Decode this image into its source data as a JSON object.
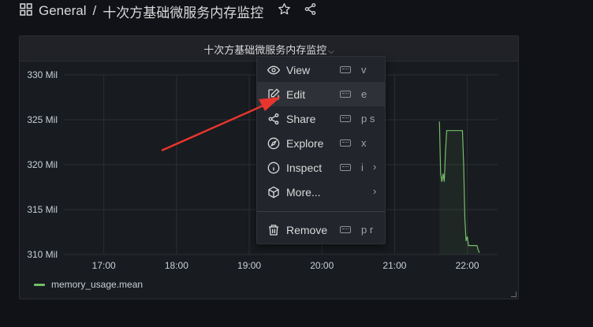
{
  "header": {
    "folder": "General",
    "separator": "/",
    "dashboard": "十次方基础微服务内存监控"
  },
  "panel": {
    "title": "十次方基础微服务内存监控",
    "legend": "memory_usage.mean"
  },
  "menu": {
    "items": [
      {
        "label": "View",
        "shortcut": "v",
        "icon": "eye-icon"
      },
      {
        "label": "Edit",
        "shortcut": "e",
        "icon": "edit-icon"
      },
      {
        "label": "Share",
        "shortcut": "p s",
        "icon": "share-icon"
      },
      {
        "label": "Explore",
        "shortcut": "x",
        "icon": "compass-icon"
      },
      {
        "label": "Inspect",
        "shortcut": "i",
        "icon": "info-icon"
      },
      {
        "label": "More...",
        "shortcut": "",
        "icon": "cube-icon"
      },
      {
        "label": "Remove",
        "shortcut": "p r",
        "icon": "trash-icon"
      }
    ]
  },
  "chart_data": {
    "type": "line",
    "ylabel": "",
    "xlabel": "",
    "ylim": [
      310,
      330
    ],
    "yticks": [
      "330 Mil",
      "325 Mil",
      "320 Mil",
      "315 Mil",
      "310 Mil"
    ],
    "xticks": [
      "17:00",
      "18:00",
      "19:00",
      "20:00",
      "21:00",
      "22:00"
    ],
    "grid": true,
    "legend_position": "bottom-left",
    "series": [
      {
        "name": "memory_usage.mean",
        "color": "#73bf69",
        "x": [
          "21:37",
          "21:38",
          "21:39",
          "21:40",
          "21:41",
          "21:42",
          "21:43",
          "21:44",
          "21:45",
          "21:46",
          "21:47",
          "21:48",
          "21:49",
          "21:50",
          "21:51",
          "21:52",
          "21:53",
          "21:54",
          "21:55",
          "21:56",
          "21:57",
          "21:58",
          "21:59",
          "22:00",
          "22:01",
          "22:02",
          "22:03",
          "22:04",
          "22:05",
          "22:06",
          "22:07",
          "22:08",
          "22:09",
          "22:10"
        ],
        "values": [
          324.8,
          319.0,
          318.1,
          319.0,
          318.1,
          321.5,
          323.8,
          323.8,
          323.8,
          323.8,
          323.8,
          323.8,
          323.8,
          323.8,
          323.8,
          323.8,
          323.8,
          323.8,
          323.8,
          323.8,
          320.0,
          314.0,
          311.5,
          312.0,
          311.0,
          311.0,
          311.0,
          311.0,
          311.0,
          311.0,
          311.0,
          311.0,
          310.5,
          310.2
        ]
      }
    ]
  },
  "colors": {
    "background": "#111217",
    "panel": "#181b1f",
    "series": "#73bf69",
    "arrow": "#e8352d"
  }
}
